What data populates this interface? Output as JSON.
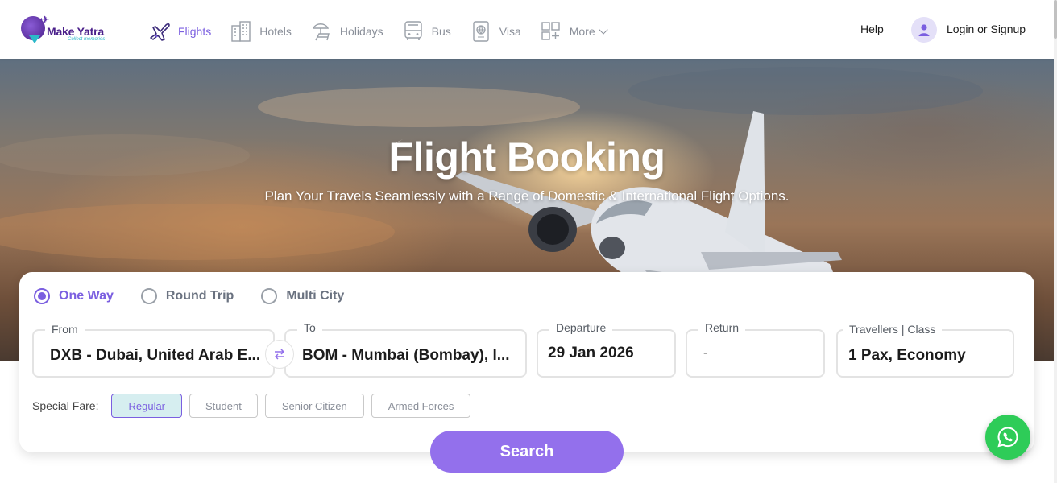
{
  "brand": {
    "name": "Make Yatra",
    "tagline": "Collect memories"
  },
  "nav": {
    "items": [
      {
        "label": "Flights",
        "icon": "airplane-icon",
        "active": true
      },
      {
        "label": "Hotels",
        "icon": "hotel-building-icon",
        "active": false
      },
      {
        "label": "Holidays",
        "icon": "beach-chair-icon",
        "active": false
      },
      {
        "label": "Bus",
        "icon": "bus-icon",
        "active": false
      },
      {
        "label": "Visa",
        "icon": "passport-icon",
        "active": false
      },
      {
        "label": "More",
        "icon": "grid-plus-icon",
        "active": false
      }
    ],
    "help": "Help",
    "login": "Login or Signup"
  },
  "hero": {
    "title": "Flight Booking",
    "subtitle": "Plan Your Travels Seamlessly with a Range of Domestic & International Flight Options."
  },
  "booking": {
    "trip_types": [
      {
        "label": "One Way",
        "selected": true
      },
      {
        "label": "Round Trip",
        "selected": false
      },
      {
        "label": "Multi City",
        "selected": false
      }
    ],
    "from": {
      "label": "From",
      "value": "DXB - Dubai, United Arab E..."
    },
    "to": {
      "label": "To",
      "value": "BOM - Mumbai (Bombay), I..."
    },
    "departure": {
      "label": "Departure",
      "value": "29 Jan 2026"
    },
    "return": {
      "label": "Return",
      "value": "-"
    },
    "travellers": {
      "label": "Travellers | Class",
      "value": "1 Pax, Economy"
    },
    "special_fare": {
      "label": "Special Fare:",
      "options": [
        {
          "label": "Regular",
          "selected": true
        },
        {
          "label": "Student",
          "selected": false
        },
        {
          "label": "Senior Citizen",
          "selected": false
        },
        {
          "label": "Armed Forces",
          "selected": false
        }
      ]
    },
    "search_label": "Search"
  },
  "colors": {
    "accent": "#7b5fe0",
    "button": "#9370ec",
    "whatsapp": "#2ecc58"
  }
}
